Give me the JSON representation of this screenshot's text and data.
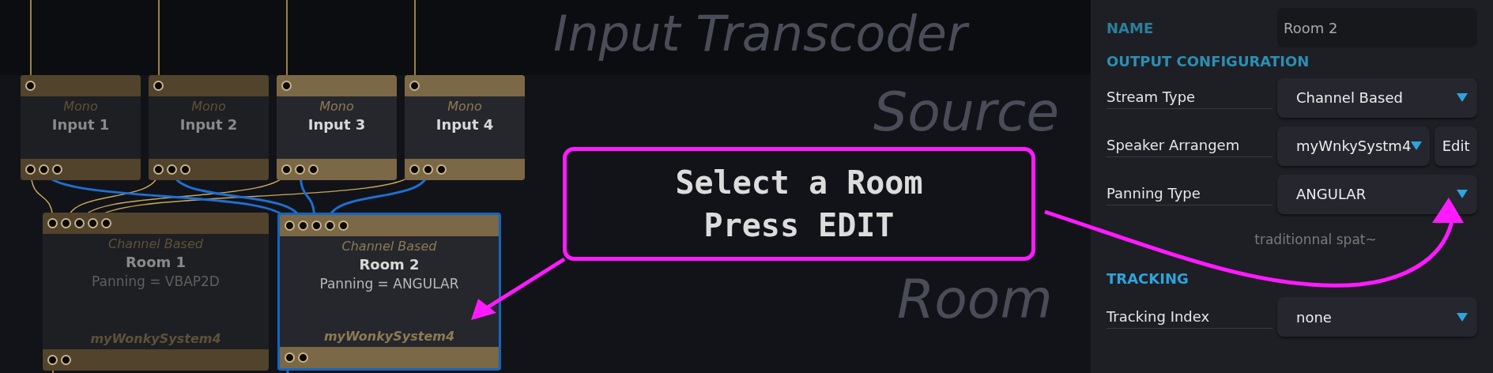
{
  "canvas_labels": [
    {
      "kind": "top",
      "text": "Input Transcoder"
    },
    {
      "kind": "middle",
      "text": "Source"
    },
    {
      "kind": "bottom",
      "text": "Room"
    }
  ],
  "nodes": [
    {
      "kind": "input",
      "subtitle": "Mono",
      "title": "Input 1",
      "active": false,
      "selected": false
    },
    {
      "kind": "input",
      "subtitle": "Mono",
      "title": "Input 2",
      "active": false,
      "selected": false
    },
    {
      "kind": "input",
      "subtitle": "Mono",
      "title": "Input 3",
      "active": true,
      "selected": false
    },
    {
      "kind": "input",
      "subtitle": "Mono",
      "title": "Input 4",
      "active": true,
      "selected": false
    },
    {
      "kind": "room",
      "subtitle": "Channel Based",
      "title": "Room 1",
      "detail": "Panning = VBAP2D",
      "footer": "myWonkySystem4",
      "active": false,
      "selected": false
    },
    {
      "kind": "room",
      "subtitle": "Channel Based",
      "title": "Room 2",
      "detail": "Panning = ANGULAR",
      "footer": "myWonkySystem4",
      "active": true,
      "selected": true
    }
  ],
  "annotation": {
    "lines": [
      "Select a Room",
      "Press EDIT"
    ]
  },
  "panel": {
    "name": {
      "label": "NAME",
      "value": "Room 2"
    },
    "output_configuration": {
      "heading": "OUTPUT CONFIGURATION",
      "rows": [
        {
          "kind": "dropdown",
          "label": "Stream Type",
          "value": "Channel Based"
        },
        {
          "kind": "dropdown_button",
          "label": "Speaker Arrangem",
          "value": "myWnkySystm4",
          "button": "Edit"
        },
        {
          "kind": "dropdown",
          "label": "Panning Type",
          "value": "ANGULAR"
        }
      ],
      "note": "traditionnal spat~"
    },
    "tracking": {
      "heading": "TRACKING",
      "rows": [
        {
          "kind": "dropdown",
          "label": "Tracking Index",
          "value": "none"
        }
      ]
    }
  }
}
